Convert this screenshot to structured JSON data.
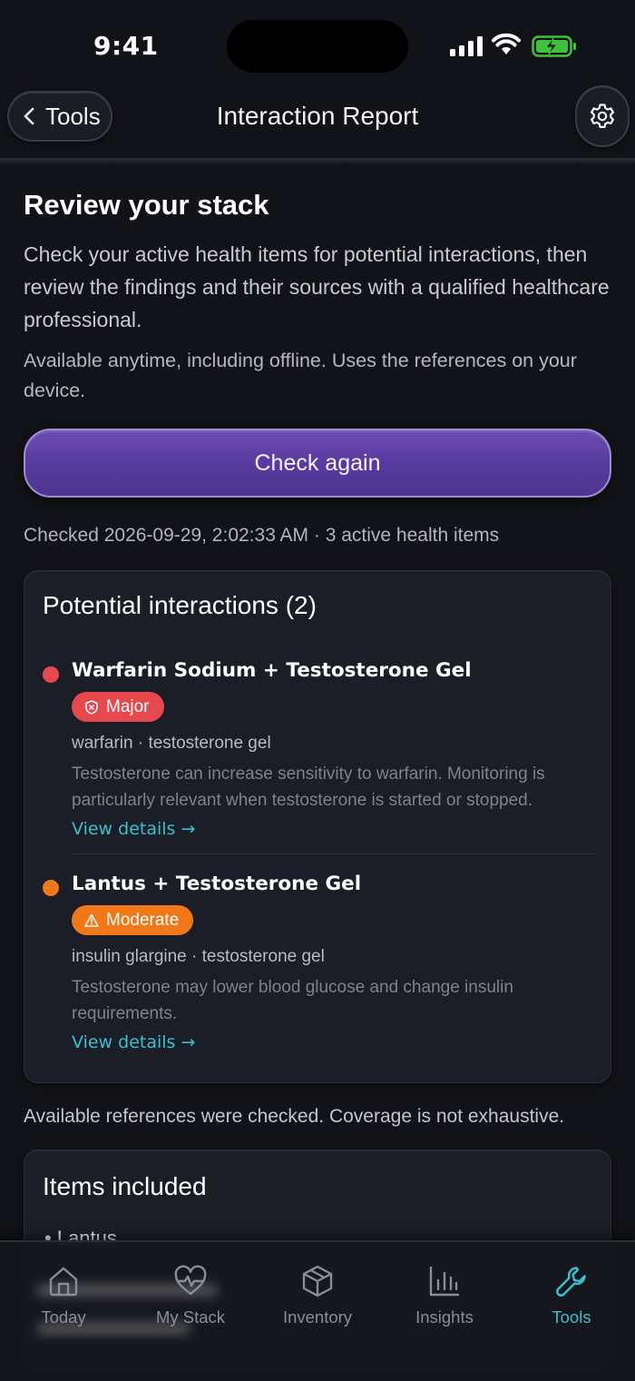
{
  "status_bar": {
    "time": "9:41"
  },
  "header": {
    "back_label": "Tools",
    "title": "Interaction Report"
  },
  "intro": {
    "heading": "Review your stack",
    "description": "Check your active health items for potential interactions, then review the findings and their sources with a qualified healthcare professional.",
    "offline_note": "Available anytime, including offline. Uses the references on your device."
  },
  "check_button_label": "Check again",
  "checked_meta": "Checked 2026-09-29, 2:02:33 AM · 3 active health items",
  "interactions": {
    "title": "Potential interactions (2)",
    "items": [
      {
        "name": "Warfarin Sodium + Testosterone Gel",
        "severity": "Major",
        "severity_color": "#e5484d",
        "drugs": "warfarin · testosterone gel",
        "description": "Testosterone can increase sensitivity to warfarin. Monitoring is particularly relevant when testosterone is started or stopped.",
        "link": "View details →"
      },
      {
        "name": "Lantus + Testosterone Gel",
        "severity": "Moderate",
        "severity_color": "#f07818",
        "drugs": "insulin glargine · testosterone gel",
        "description": "Testosterone may lower blood glucose and change insulin requirements.",
        "link": "View details →"
      }
    ]
  },
  "coverage_note": "Available references were checked. Coverage is not exhaustive.",
  "items_included": {
    "title": "Items included",
    "items": [
      "Lantus"
    ]
  },
  "tabbar": {
    "tabs": [
      {
        "label": "Today",
        "icon": "home-icon"
      },
      {
        "label": "My Stack",
        "icon": "heart-pulse-icon"
      },
      {
        "label": "Inventory",
        "icon": "box-icon"
      },
      {
        "label": "Insights",
        "icon": "bar-chart-icon"
      },
      {
        "label": "Tools",
        "icon": "wrench-icon",
        "active": true
      }
    ],
    "accent_color": "#3bbfcf"
  }
}
